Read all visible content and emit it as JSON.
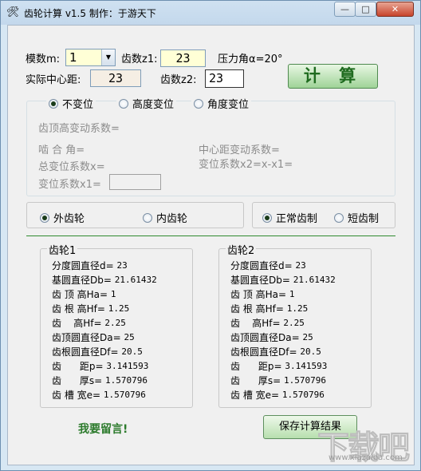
{
  "window": {
    "title": "齿轮计算 v1.5  制作：于游天下",
    "icon": "gear-tools-icon"
  },
  "inputs": {
    "module_label": "模数m:",
    "module_value": "1",
    "teeth_z1_label": "齿数z1:",
    "teeth_z1_value": "23",
    "pressure_angle_label": "压力角α=20°",
    "center_distance_label": "实际中心距:",
    "center_distance_value": "23",
    "teeth_z2_label": "齿数z2:",
    "teeth_z2_value": "23",
    "calc_button": "计 算"
  },
  "shift_mode": {
    "options": [
      "不变位",
      "高度变位",
      "角度变位"
    ],
    "selected": 0,
    "fields": {
      "addendum_change": "齿顶高变动系数=",
      "working_angle": "啮 合 角=",
      "center_shift_coef": "中心距变动系数=",
      "total_shift": "总变位系数x=",
      "shift_x2": "变位系数x2=x-x1=",
      "shift_x1": "变位系数x1="
    }
  },
  "gear_type": {
    "options": [
      "外齿轮",
      "内齿轮"
    ],
    "selected": 0
  },
  "tooth_system": {
    "options": [
      "正常齿制",
      "短齿制"
    ],
    "selected": 0
  },
  "gear1": {
    "title": "齿轮1",
    "rows": [
      {
        "label": "分度圆直径d= ",
        "value": "23"
      },
      {
        "label": "基圆直径Db= ",
        "value": "21.61432"
      },
      {
        "label": "齿 顶 高Ha= ",
        "value": "1"
      },
      {
        "label": "齿 根 高Hf= ",
        "value": "1.25"
      },
      {
        "label": "齿    高Hf= ",
        "value": "2.25"
      },
      {
        "label": "齿顶圆直径Da= ",
        "value": "25"
      },
      {
        "label": "齿根圆直径Df= ",
        "value": "20.5"
      },
      {
        "label": "齿      距p= ",
        "value": "3.141593"
      },
      {
        "label": "齿      厚s= ",
        "value": "1.570796"
      },
      {
        "label": "齿 槽 宽e= ",
        "value": "1.570796"
      }
    ]
  },
  "gear2": {
    "title": "齿轮2",
    "rows": [
      {
        "label": "分度圆直径d= ",
        "value": "23"
      },
      {
        "label": "基圆直径Db= ",
        "value": "21.61432"
      },
      {
        "label": "齿 顶 高Ha= ",
        "value": "1"
      },
      {
        "label": "齿 根 高Hf= ",
        "value": "1.25"
      },
      {
        "label": "齿    高Hf= ",
        "value": "2.25"
      },
      {
        "label": "齿顶圆直径Da= ",
        "value": "25"
      },
      {
        "label": "齿根圆直径Df= ",
        "value": "20.5"
      },
      {
        "label": "齿      距p= ",
        "value": "3.141593"
      },
      {
        "label": "齿      厚s= ",
        "value": "1.570796"
      },
      {
        "label": "齿 槽 宽e= ",
        "value": "1.570796"
      }
    ]
  },
  "footer": {
    "message_link": "我要留言!",
    "save_button": "保存计算结果"
  },
  "watermark": {
    "logo_text": "下载吧",
    "url_text": "www.xiazaiba.com"
  },
  "colors": {
    "input_bg": "#ffffd6",
    "accent_green": "#2b7a2b",
    "title_bar": "#c3d8ec"
  }
}
